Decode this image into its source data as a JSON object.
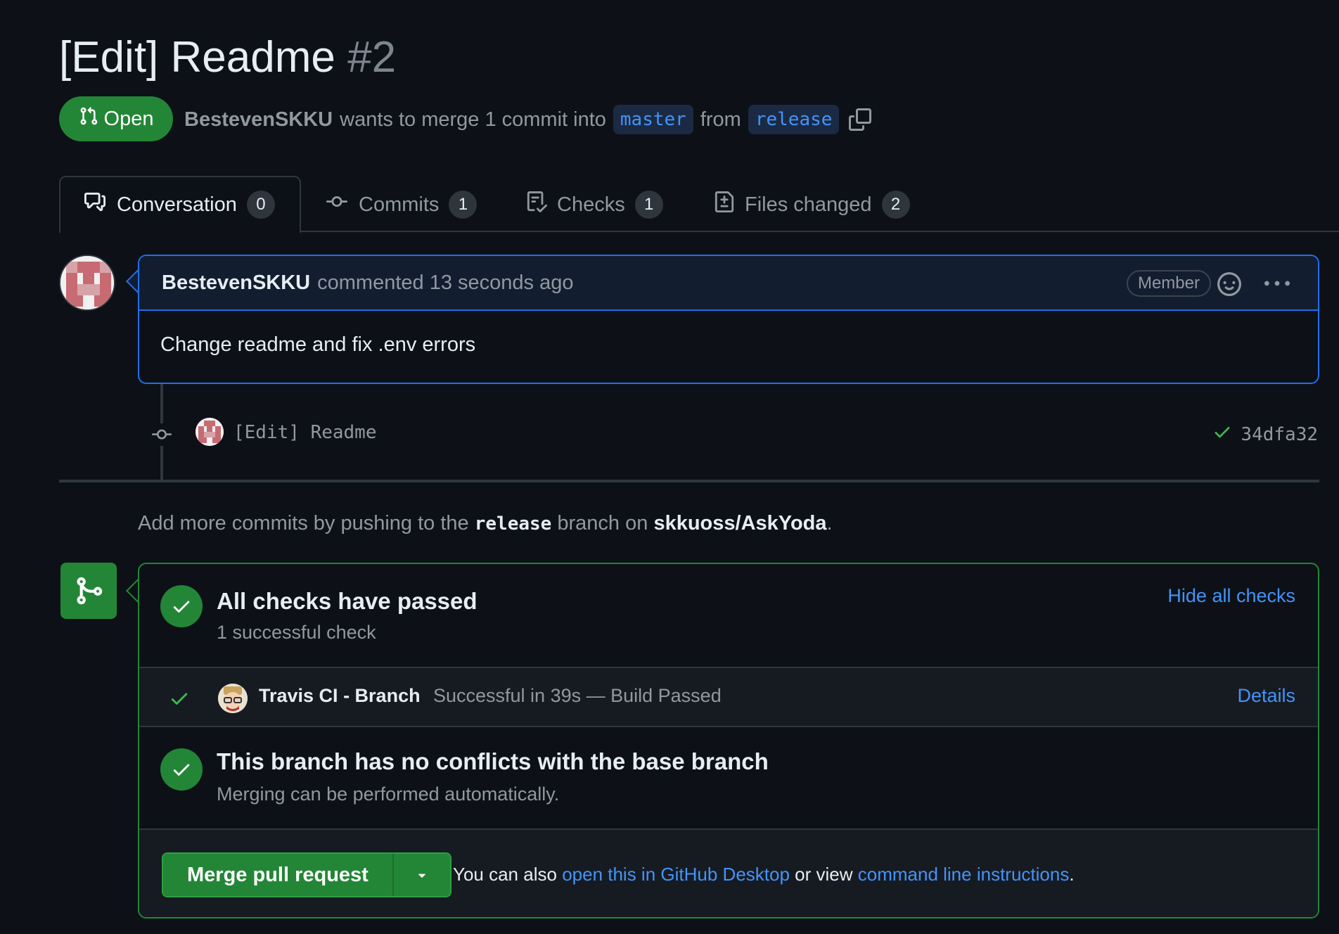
{
  "pr": {
    "title": "[Edit] Readme",
    "number": "#2",
    "state": "Open",
    "author": "BestevenSKKU",
    "merge_text": "wants to merge 1 commit into",
    "base_branch": "master",
    "from_text": "from",
    "head_branch": "release"
  },
  "tabs": [
    {
      "label": "Conversation",
      "count": "0"
    },
    {
      "label": "Commits",
      "count": "1"
    },
    {
      "label": "Checks",
      "count": "1"
    },
    {
      "label": "Files changed",
      "count": "2"
    }
  ],
  "comment": {
    "author": "BestevenSKKU",
    "action": "commented 13 seconds ago",
    "badge": "Member",
    "body": "Change readme and fix .env errors"
  },
  "commit": {
    "message": "[Edit] Readme",
    "sha": "34dfa32"
  },
  "push_hint": {
    "prefix": "Add more commits by pushing to the",
    "branch": "release",
    "middle": "branch on",
    "repo": "skkuoss/AskYoda",
    "suffix": "."
  },
  "checks": {
    "title": "All checks have passed",
    "subtitle": "1 successful check",
    "hide_label": "Hide all checks",
    "items": [
      {
        "name": "Travis CI - Branch",
        "description": "Successful in 39s — Build Passed",
        "link": "Details"
      }
    ]
  },
  "conflicts": {
    "title": "This branch has no conflicts with the base branch",
    "subtitle": "Merging can be performed automatically."
  },
  "merge": {
    "button": "Merge pull request",
    "note_prefix": "You can also",
    "desktop_link": "open this in GitHub Desktop",
    "note_middle": "or view",
    "cli_link": "command line instructions",
    "note_suffix": "."
  },
  "colors": {
    "background": "#0d1117",
    "accent_green": "#238636",
    "link_blue": "#4493f8",
    "border": "#30363d"
  }
}
